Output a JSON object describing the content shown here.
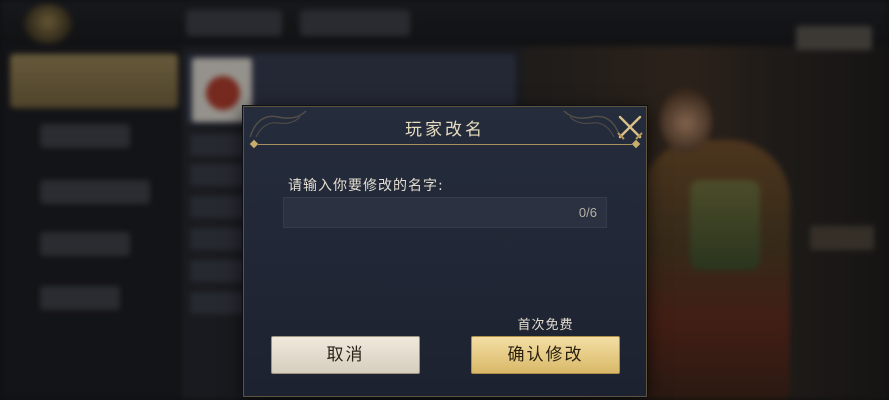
{
  "dialog": {
    "title": "玩家改名",
    "prompt": "请输入你要修改的名字:",
    "input_value": "",
    "input_placeholder": "",
    "char_counter": "0/6",
    "cancel_label": "取消",
    "confirm_label": "确认修改",
    "confirm_note": "首次免费",
    "close_icon": "close-swords-icon"
  },
  "colors": {
    "dialog_bg": "#252c3c",
    "gold_accent": "#c9ad6c",
    "confirm_button": "#e6c880",
    "cancel_button": "#e6e0d2",
    "text_light": "#e3ddd0"
  }
}
